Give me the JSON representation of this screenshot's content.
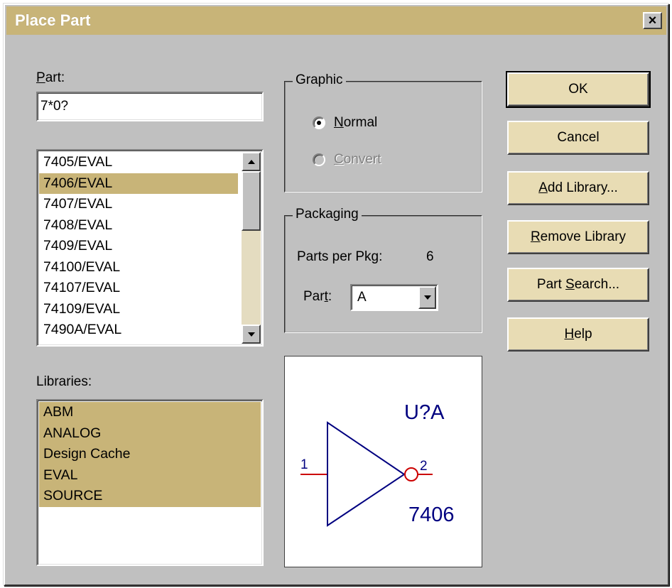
{
  "window": {
    "title": "Place Part",
    "close_glyph": "×"
  },
  "part": {
    "label_prefix": "",
    "label_hotkey": "P",
    "label_rest": "art:",
    "value": "7*0?"
  },
  "parts_list": {
    "items": [
      "7405/EVAL",
      "7406/EVAL",
      "7407/EVAL",
      "7408/EVAL",
      "7409/EVAL",
      "74100/EVAL",
      "74107/EVAL",
      "74109/EVAL",
      "7490A/EVAL"
    ],
    "selected_index": 1
  },
  "libraries": {
    "label": "Libraries:",
    "items": [
      "ABM",
      "ANALOG",
      "Design Cache",
      "EVAL",
      "SOURCE"
    ]
  },
  "graphic": {
    "legend": "Graphic",
    "normal_hotkey": "N",
    "normal_rest": "ormal",
    "convert_hotkey": "C",
    "convert_rest": "onvert",
    "selected": "normal"
  },
  "packaging": {
    "legend": "Packaging",
    "parts_per_pkg_label": "Parts per Pkg:",
    "parts_per_pkg_value": "6",
    "part_label_pre": "Par",
    "part_label_hotkey": "t",
    "part_label_post": ":",
    "part_value": "A"
  },
  "preview": {
    "refdes": "U?A",
    "part_name": "7406",
    "pin_in": "1",
    "pin_out": "2",
    "pin_color": "#cc0000",
    "body_color": "#000080",
    "text_color": "#000080"
  },
  "buttons": {
    "ok": "OK",
    "cancel": "Cancel",
    "add_library_hotkey": "A",
    "add_library_rest": "dd Library...",
    "remove_library_hotkey": "R",
    "remove_library_rest": "emove Library",
    "part_search_pre": "Part ",
    "part_search_hotkey": "S",
    "part_search_rest": "earch...",
    "help_hotkey": "H",
    "help_rest": "elp"
  },
  "colors": {
    "accent": "#c8b478",
    "face": "#c0c0c0",
    "button_face": "#e8dcb4"
  }
}
